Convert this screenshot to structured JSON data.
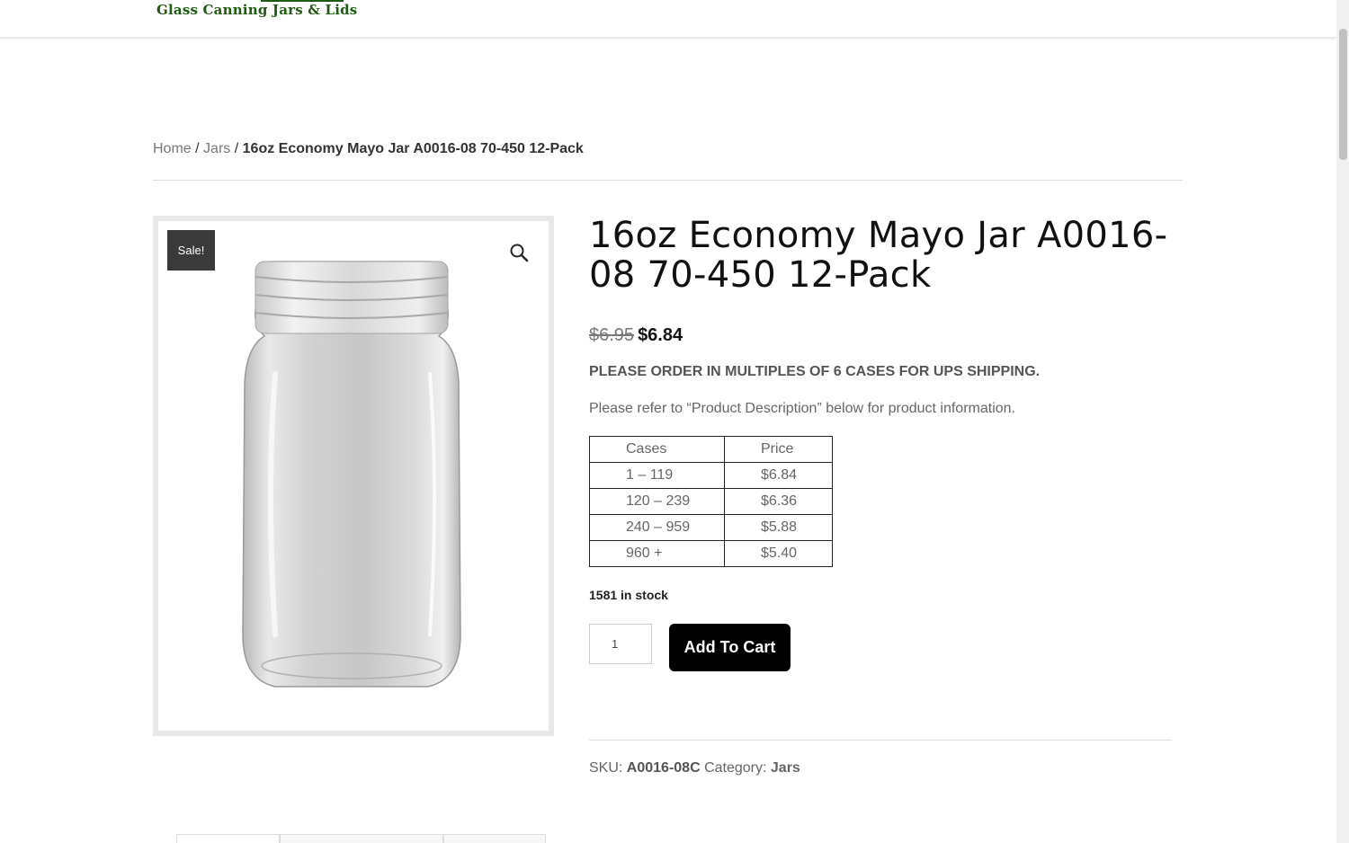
{
  "header": {
    "logo_text": "Glass Canning Jars & Lids"
  },
  "breadcrumb": {
    "home": "Home",
    "separator": "/",
    "category": "Jars",
    "current": "16oz Economy Mayo Jar A0016-08 70-450 12-Pack"
  },
  "gallery": {
    "badge": "Sale!",
    "zoom_icon": "magnifier-icon"
  },
  "product": {
    "title": "16oz Economy Mayo Jar A0016-08 70-450 12-Pack",
    "price_old": "$6.95",
    "price_new": "$6.84",
    "notice": "PLEASE ORDER IN MULTIPLES OF 6 CASES FOR UPS SHIPPING.",
    "refer": "Please refer to “Product Description” below for product information.",
    "stock": "1581 in stock",
    "quantity": "1",
    "add_to_cart_label": "Add To Cart",
    "sku_label": "SKU:",
    "sku": "A0016-08C",
    "category_label": "Category:",
    "category": "Jars"
  },
  "pricing_table": {
    "headers": [
      "Cases",
      "Price"
    ],
    "rows": [
      [
        "1 – 119",
        "$6.84"
      ],
      [
        "120 – 239",
        "$6.36"
      ],
      [
        "240 – 959",
        "$5.88"
      ],
      [
        "960 +",
        "$5.40"
      ]
    ]
  },
  "colors": {
    "logo_green": "#1f5a12",
    "button_bg": "#000000",
    "badge_bg": "#3a3a3a"
  }
}
